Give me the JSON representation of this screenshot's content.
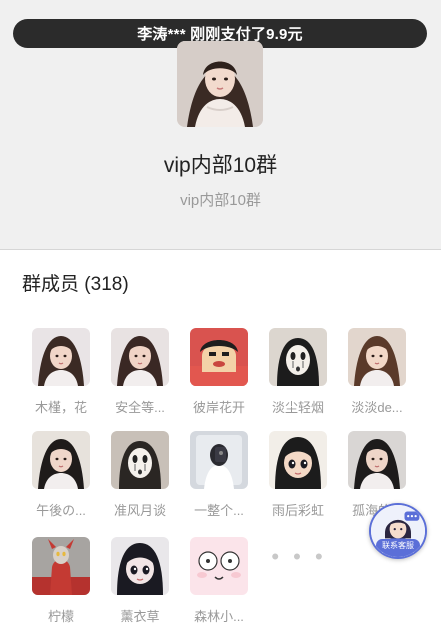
{
  "ticker": {
    "text": "李涛*** 刚刚支付了9.9元"
  },
  "group": {
    "title": "vip内部10群",
    "subtitle": "vip内部10群"
  },
  "members_section": {
    "label": "群成员",
    "count": "(318)"
  },
  "members": [
    {
      "name": "木槿，花",
      "icon": "girl-avatar",
      "colors": [
        "#e9e4e6",
        "#3b2a24",
        "#f1d6c8"
      ]
    },
    {
      "name": "安全等...",
      "icon": "girl-avatar",
      "colors": [
        "#e8e2e2",
        "#3a2824",
        "#f0d4c6"
      ]
    },
    {
      "name": "彼岸花开",
      "icon": "cartoon-avatar",
      "colors": [
        "#d9534f",
        "#1e1e1e",
        "#f3d2a8"
      ]
    },
    {
      "name": "淡尘轻烟",
      "icon": "ghost-mask-avatar",
      "colors": [
        "#dcd6cf",
        "#1c1c1c",
        "#f4f0ea"
      ]
    },
    {
      "name": "淡淡de...",
      "icon": "girl-avatar",
      "colors": [
        "#e2d6cd",
        "#5a3a2a",
        "#f2d8c8"
      ]
    },
    {
      "name": "午後の...",
      "icon": "girl-avatar",
      "colors": [
        "#e7e2dc",
        "#1f1b1a",
        "#f0d6c9"
      ]
    },
    {
      "name": "准风月谈",
      "icon": "ghost-mask-avatar",
      "colors": [
        "#c8c0b8",
        "#2a2623",
        "#f5f1ec"
      ]
    },
    {
      "name": "一整个...",
      "icon": "mirror-selfie-avatar",
      "colors": [
        "#d4d8de",
        "#2a2a30",
        "#bfc6d0"
      ]
    },
    {
      "name": "雨后彩虹",
      "icon": "anime-girl-avatar",
      "colors": [
        "#f2eee8",
        "#1c1c1c",
        "#f4d9c6"
      ]
    },
    {
      "name": "孤海的...",
      "icon": "girl-avatar",
      "colors": [
        "#d9d6d4",
        "#1d1b1b",
        "#eed5c8"
      ]
    },
    {
      "name": "柠檬",
      "icon": "hero-figure-avatar",
      "colors": [
        "#a7a4a1",
        "#b5322e",
        "#6e6a66"
      ]
    },
    {
      "name": "薰衣草",
      "icon": "anime-girl-avatar",
      "colors": [
        "#e9e7ea",
        "#1a1a22",
        "#f2e6e6"
      ]
    },
    {
      "name": "森林小...",
      "icon": "cartoon-face-avatar",
      "colors": [
        "#fbe4ea",
        "#333333",
        "#f7c9d2"
      ]
    }
  ],
  "more": {
    "label": "• • •"
  },
  "customer_service": {
    "label": "联系客服",
    "icon": "customer-service-icon",
    "accent": "#5b6fd8"
  },
  "theme": {
    "header_bg": "#f0f0f0",
    "ticker_bg": "#2b2b2b",
    "name_color": "#999999"
  }
}
